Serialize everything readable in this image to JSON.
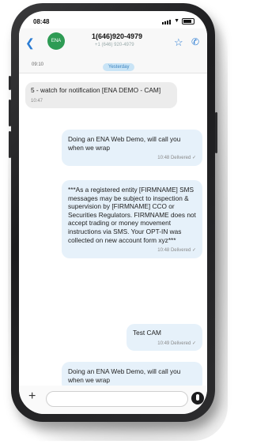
{
  "status": {
    "time": "08:48"
  },
  "header": {
    "back_icon": "chevron-left-icon",
    "avatar_text": "ENA",
    "contact_name": "1(646)920-4979",
    "contact_subtitle": "+1 (646) 920-4979",
    "star_icon": "star-icon",
    "phone_icon": "phone-icon",
    "prev_time": "09:10",
    "day_label": "Yesterday"
  },
  "messages": [
    {
      "direction": "in",
      "text": "5 - watch for notification [ENA DEMO - CAM]",
      "time": "10:47",
      "status": ""
    },
    {
      "direction": "out",
      "text": "Doing an ENA Web Demo, will call you when we wrap",
      "time": "10:48",
      "status": "Delivered"
    },
    {
      "direction": "out",
      "text": "***As a registered entity [FIRMNAME] SMS messages may be subject to inspection & supervision by [FIRMNAME] CCO or Securities Regulators. FIRMNAME does not accept trading or money movement instructions via SMS. Your OPT-IN was collected on new account form xyz***",
      "time": "10:48",
      "status": "Delivered"
    },
    {
      "direction": "out",
      "text": "Test CAM",
      "time": "10:49",
      "status": "Delivered"
    },
    {
      "direction": "out",
      "text": "Doing an ENA Web Demo, will call you when we wrap",
      "time": "",
      "status": ""
    }
  ],
  "composer": {
    "plus_icon": "plus-icon",
    "mic_icon": "microphone-icon"
  },
  "colors": {
    "accent": "#2b7cd3",
    "avatar": "#2e9b54",
    "outgoing_bubble": "#e6f1fa",
    "incoming_bubble": "#ececec"
  }
}
